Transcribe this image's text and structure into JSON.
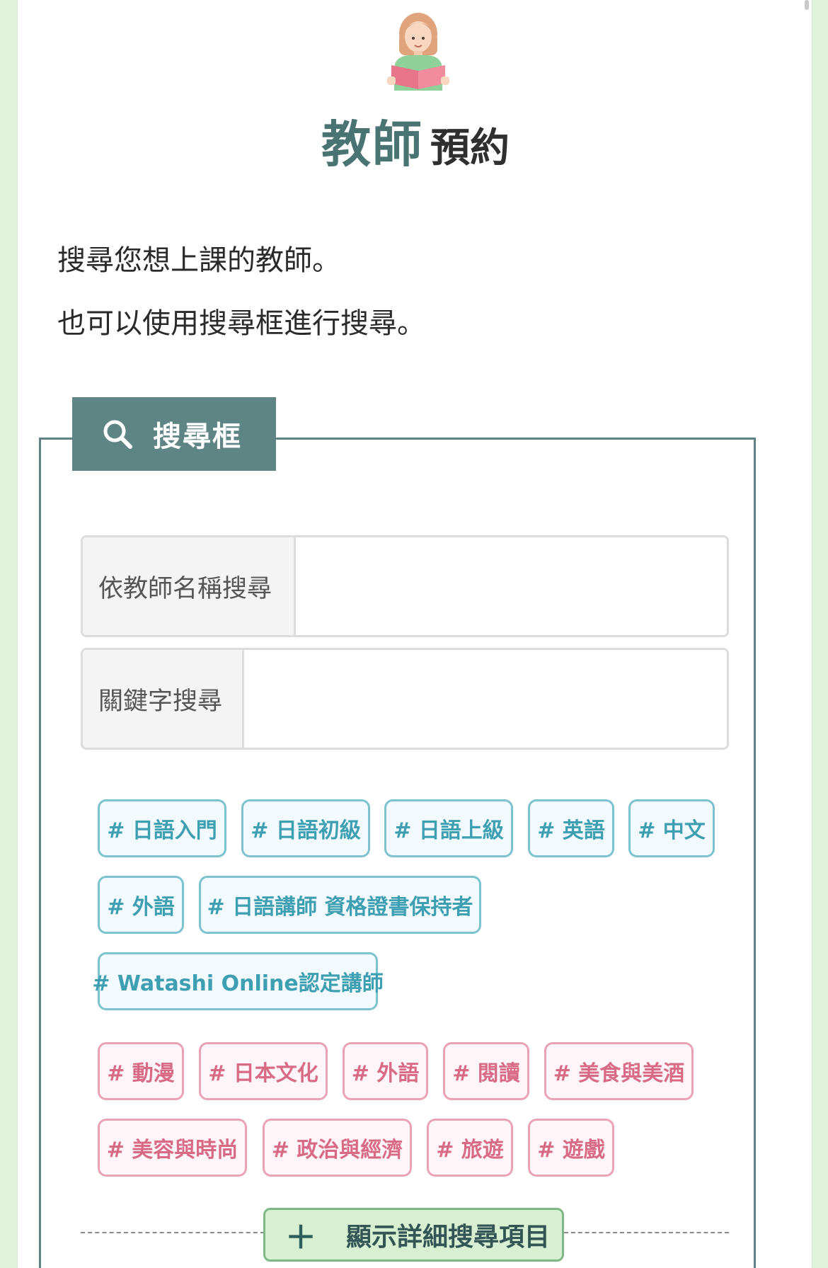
{
  "header": {
    "title_main": "教師",
    "title_sub": "預約",
    "icon": "teacher-reading-icon"
  },
  "intro": {
    "line1": "搜尋您想上課的教師。",
    "line2": "也可以使用搜尋框進行搜尋。"
  },
  "search": {
    "tab_label": "搜尋框",
    "tab_icon": "search-icon",
    "name_label": "依教師名稱搜尋",
    "name_value": "",
    "keyword_label": "關鍵字搜尋",
    "keyword_value": ""
  },
  "blue_tags": [
    "# 日語入門",
    "# 日語初級",
    "# 日語上級",
    "# 英語",
    "# 中文",
    "# 外語",
    "# 日語講師 資格證書保持者",
    "# Watashi Online認定講師"
  ],
  "pink_tags": [
    "# 動漫",
    "# 日本文化",
    "# 外語",
    "# 閱讀",
    "# 美食與美酒",
    "# 美容與時尚",
    "# 政治與經濟",
    "# 旅遊",
    "# 遊戲"
  ],
  "detail_button": {
    "icon": "plus-icon",
    "label": "顯示詳細搜尋項目"
  },
  "colors": {
    "accent_teal": "#5e8584",
    "tag_blue": "#3e9fb2",
    "tag_pink": "#d96a86",
    "page_bg": "#dff3d8"
  }
}
